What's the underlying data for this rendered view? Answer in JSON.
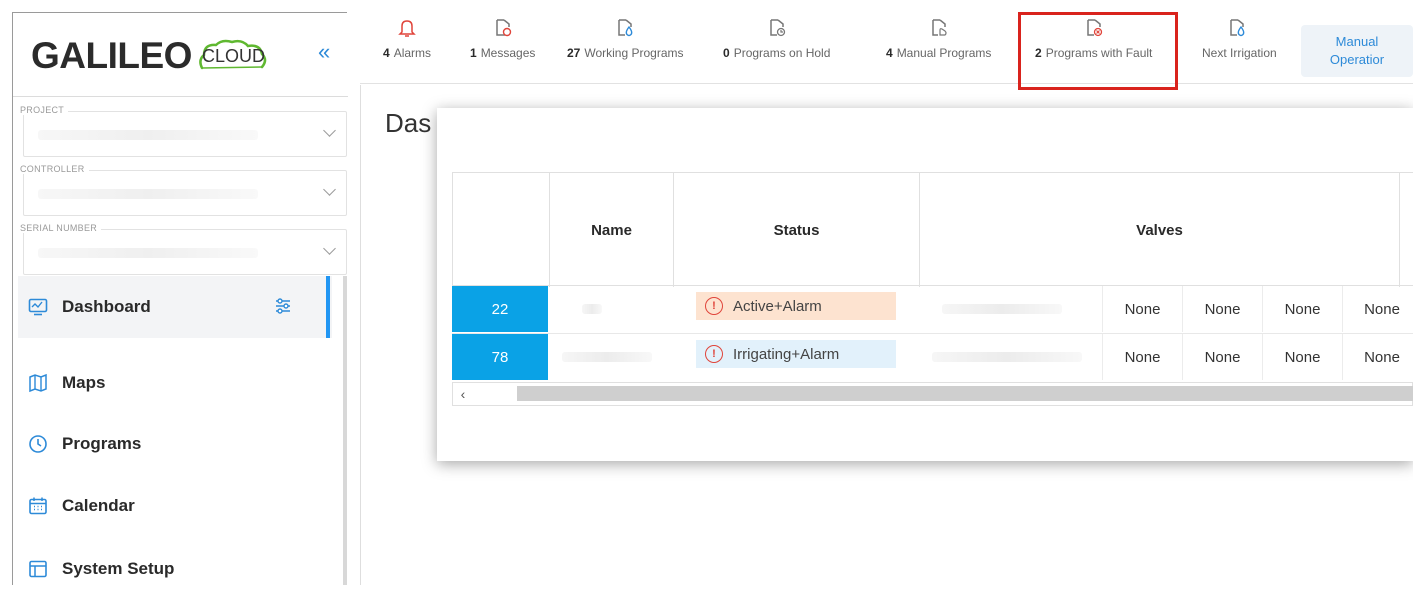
{
  "brand": {
    "main": "GALILEO",
    "cloud": "CLOUD",
    "collapse_glyph": "«"
  },
  "filters": [
    {
      "label": "PROJECT"
    },
    {
      "label": "CONTROLLER"
    },
    {
      "label": "SERIAL NUMBER"
    }
  ],
  "nav": [
    {
      "label": "Dashboard",
      "icon": "dashboard-icon"
    },
    {
      "label": "Maps",
      "icon": "map-icon"
    },
    {
      "label": "Programs",
      "icon": "clock-icon"
    },
    {
      "label": "Calendar",
      "icon": "calendar-icon"
    },
    {
      "label": "System Setup",
      "icon": "system-setup-icon"
    }
  ],
  "header": {
    "items": [
      {
        "count": "4",
        "label": "Alarms",
        "icon": "bell-icon"
      },
      {
        "count": "1",
        "label": "Messages",
        "icon": "message-icon"
      },
      {
        "count": "27",
        "label": "Working Programs",
        "icon": "drop-icon"
      },
      {
        "count": "0",
        "label": "Programs on Hold",
        "icon": "hold-icon"
      },
      {
        "count": "4",
        "label": "Manual Programs",
        "icon": "manual-icon"
      },
      {
        "count": "2",
        "label": "Programs with Fault",
        "icon": "fault-icon"
      },
      {
        "count": "",
        "label": "Next Irrigation",
        "icon": "drop-icon"
      }
    ],
    "manual_button": {
      "line1": "Manual",
      "line2": "Operatior"
    }
  },
  "page": {
    "title": "Das"
  },
  "table": {
    "columns": [
      "",
      "Name",
      "Status",
      "Valves"
    ],
    "rows": [
      {
        "id": "22",
        "status": "Active+Alarm",
        "status_bg": "#fde3d0",
        "valves": [
          "None",
          "None",
          "None",
          "None"
        ]
      },
      {
        "id": "78",
        "status": "Irrigating+Alarm",
        "status_bg": "#e2f1fb",
        "valves": [
          "None",
          "None",
          "None",
          "None"
        ]
      }
    ],
    "scroll_left_glyph": "‹"
  },
  "colors": {
    "accent": "#2196f3",
    "id_cell": "#0aa2e6",
    "alert": "#d9231d"
  }
}
